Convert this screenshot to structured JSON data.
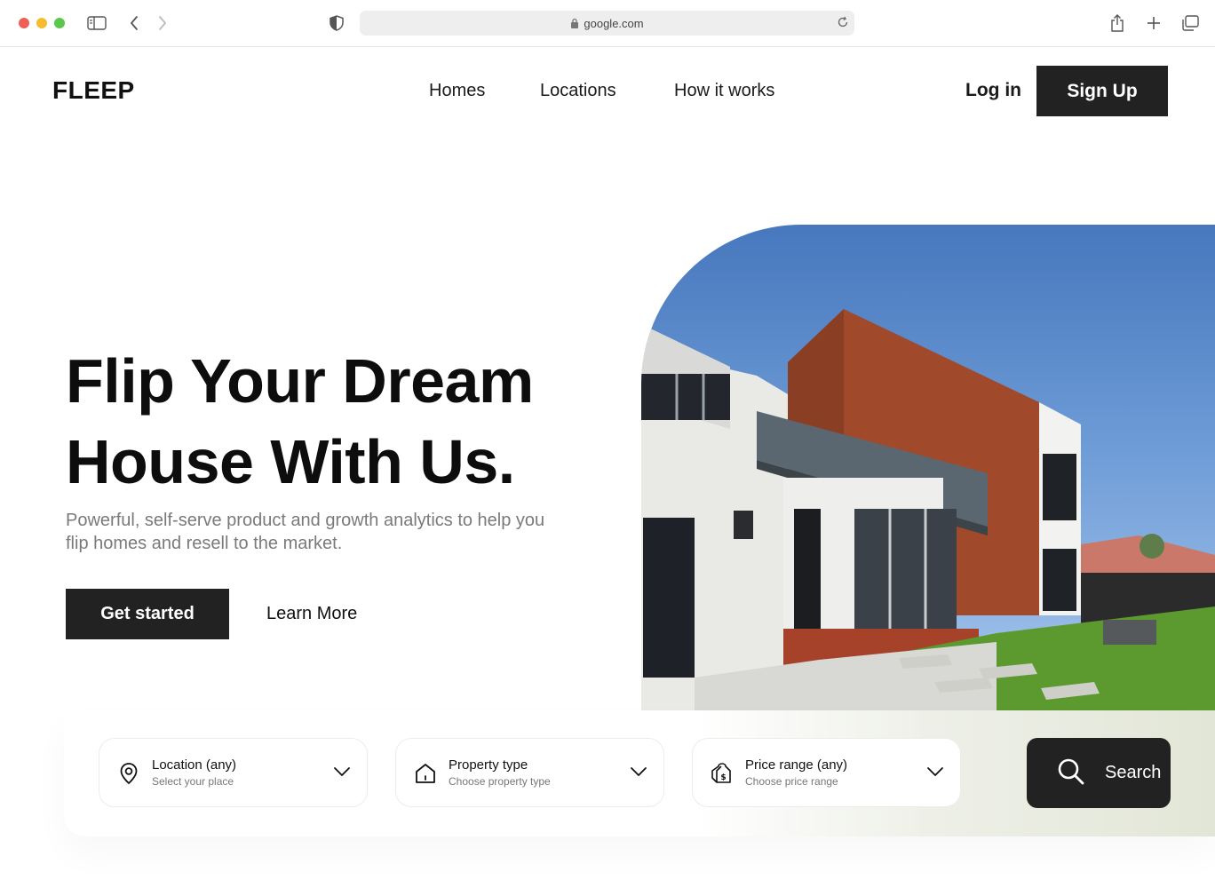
{
  "browser": {
    "url": "google.com"
  },
  "nav": {
    "logo": "FLEEP",
    "links": [
      "Homes",
      "Locations",
      "How it works"
    ],
    "login": "Log in",
    "signup": "Sign Up"
  },
  "hero": {
    "title_line1": "Flip Your Dream",
    "title_line2": "House With Us.",
    "subtitle": "Powerful, self-serve product and growth analytics to help you flip homes and resell to the market.",
    "primary_cta": "Get started",
    "secondary_cta": "Learn More"
  },
  "search": {
    "fields": [
      {
        "label": "Location (any)",
        "hint": "Select your place",
        "icon": "location-pin-icon"
      },
      {
        "label": "Property type",
        "hint": "Choose property type",
        "icon": "house-icon"
      },
      {
        "label": "Price range (any)",
        "hint": "Choose price range",
        "icon": "price-tag-icon"
      }
    ],
    "button": "Search"
  },
  "colors": {
    "primary": "#222222",
    "muted_text": "#7a7a7a",
    "page_bg": "#ffffff"
  }
}
